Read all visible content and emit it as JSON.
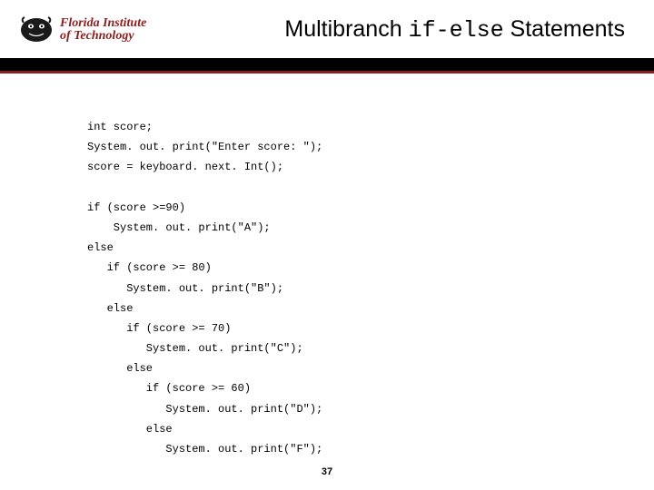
{
  "header": {
    "logo_line1": "Florida Institute",
    "logo_line2": "of Technology",
    "title_prefix": "Multibranch ",
    "title_code": "if-else",
    "title_suffix": " Statements"
  },
  "code": "int score;\nSystem. out. print(\"Enter score: \");\nscore = keyboard. next. Int();\n\nif (score >=90)\n    System. out. print(\"A\");\nelse\n   if (score >= 80)\n      System. out. print(\"B\");\n   else\n      if (score >= 70)\n         System. out. print(\"C\");\n      else\n         if (score >= 60)\n            System. out. print(\"D\");\n         else\n            System. out. print(\"F\");",
  "page_number": "37"
}
